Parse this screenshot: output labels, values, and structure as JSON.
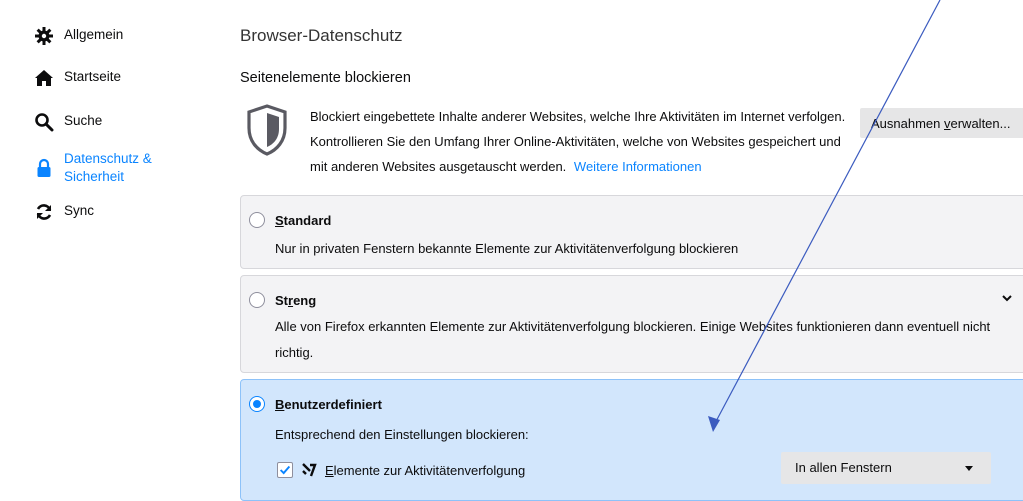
{
  "sidebar": {
    "items": [
      {
        "label": "Allgemein",
        "icon": "gear-icon"
      },
      {
        "label": "Startseite",
        "icon": "home-icon"
      },
      {
        "label": "Suche",
        "icon": "search-icon"
      },
      {
        "label_line1": "Datenschutz &",
        "label_line2": "Sicherheit",
        "icon": "lock-icon",
        "active": true
      },
      {
        "label": "Sync",
        "icon": "sync-icon"
      }
    ]
  },
  "main": {
    "title": "Browser-Datenschutz",
    "section_title": "Seitenelemente blockieren",
    "description": "Blockiert eingebettete Inhalte anderer Websites, welche Ihre Aktivitäten im Internet verfolgen. Kontrollieren Sie den Umfang Ihrer Online-Aktivitäten, welche von Websites gespeichert und mit anderen Websites ausgetauscht werden.",
    "more_info_link": "Weitere Informationen",
    "exceptions_button_prefix": "Ausnahmen ",
    "exceptions_button_accesskey": "v",
    "exceptions_button_suffix": "erwalten...",
    "options": {
      "standard": {
        "title_accesskey": "S",
        "title_rest": "tandard",
        "description": "Nur in privaten Fenstern bekannte Elemente zur Aktivitätenverfolgung blockieren",
        "checked": false
      },
      "strict": {
        "title_pre": "St",
        "title_accesskey": "r",
        "title_rest": "eng",
        "description": "Alle von Firefox erkannten Elemente zur Aktivitätenverfolgung blockieren. Einige Websites funktionieren dann eventuell nicht richtig.",
        "checked": false
      },
      "custom": {
        "title_accesskey": "B",
        "title_rest": "enutzerdefiniert",
        "description": "Entsprechend den Einstellungen blockieren:",
        "checked": true,
        "trackers": {
          "label_accesskey": "E",
          "label_rest": "lemente zur Aktivitätenverfolgung",
          "checked": true,
          "select_value": "In allen Fenstern"
        }
      }
    }
  },
  "colors": {
    "accent": "#0a84ff",
    "annotation_arrow": "#3b5bbf",
    "selected_bg": "#d2e6fc",
    "option_bg": "#f3f3f5"
  }
}
